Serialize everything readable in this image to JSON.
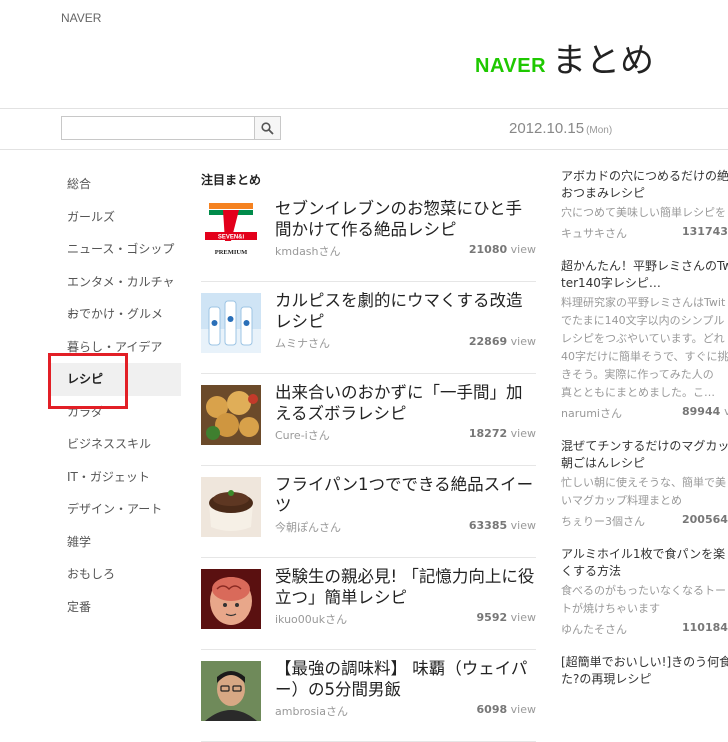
{
  "header": {
    "naver_label": "NAVER",
    "logo_naver": "NAVER",
    "logo_matome": "まとめ",
    "date": "2012.10.15",
    "day_of_week": "(Mon)"
  },
  "search": {
    "placeholder": "",
    "value": ""
  },
  "nav": {
    "items": [
      {
        "label": "総合"
      },
      {
        "label": "ガールズ"
      },
      {
        "label": "ニュース・ゴシップ"
      },
      {
        "label": "エンタメ・カルチャー"
      },
      {
        "label": "おでかけ・グルメ"
      },
      {
        "label": "暮らし・アイデア"
      },
      {
        "label": "レシピ"
      },
      {
        "label": "カラダ"
      },
      {
        "label": "ビジネススキル"
      },
      {
        "label": "IT・ガジェット"
      },
      {
        "label": "デザイン・アート"
      },
      {
        "label": "雑学"
      },
      {
        "label": "おもしろ"
      },
      {
        "label": "定番"
      }
    ],
    "active": "レシピ"
  },
  "main": {
    "section_title": "注目まとめ",
    "view_label": "view",
    "cards": [
      {
        "title": "セブンイレブンのお惣菜にひと手間かけて作る絶品レシピ",
        "author": "kmdashさん",
        "views": "21080",
        "thumb": "seven-eleven-premium"
      },
      {
        "title": "カルピスを劇的にウマくする改造レシピ",
        "author": "ムミナさん",
        "views": "22869",
        "thumb": "calpis-bottles"
      },
      {
        "title": "出来合いのおかずに「一手間」加えるズボラレシピ",
        "author": "Cure-iさん",
        "views": "18272",
        "thumb": "fried-food"
      },
      {
        "title": "フライパン1つでできる絶品スイーツ",
        "author": "今朝ぽんさん",
        "views": "63385",
        "thumb": "cake"
      },
      {
        "title": "受験生の親必見! 「記憶力向上に役立つ」簡単レシピ",
        "author": "ikuo00ukさん",
        "views": "9592",
        "thumb": "brain-illustration"
      },
      {
        "title": "【最強の調味料】 味覇（ウェイパー）の5分間男飯",
        "author": "ambrosiaさん",
        "views": "6098",
        "thumb": "portrait"
      }
    ]
  },
  "side": {
    "items": [
      {
        "title": [
          "アボカドの穴につめるだけの絶",
          "おつまみレシピ"
        ],
        "desc": [
          "穴につめて美味しい簡単レシピを"
        ],
        "author": "キュサキさん",
        "views": "131743",
        "view_label": "v"
      },
      {
        "title": [
          "超かんたん！平野レミさんのTw",
          "ter140字レシピ…"
        ],
        "desc": [
          "料理研究家の平野レミさんはTwit",
          "でたまに140文字以内のシンプル",
          "レシピをつぶやいています。どれ",
          "40字だけに簡単そうで、すぐに挑",
          "きそう。実際に作ってみた人の",
          "真とともにまとめました。こ…"
        ],
        "author": "narumiさん",
        "views": "89944",
        "view_label": "v"
      },
      {
        "title": [
          "混ぜてチンするだけのマグカッ",
          "朝ごはんレシピ"
        ],
        "desc": [
          "忙しい朝に使えそうな、簡単で美",
          "いマグカップ料理まとめ"
        ],
        "author": "ちぇりー3個さん",
        "views": "200564",
        "view_label": "v"
      },
      {
        "title": [
          "アルミホイル1枚で食パンを楽",
          "くする方法"
        ],
        "desc": [
          "食べるのがもったいなくなるトー",
          "トが焼けちゃいます"
        ],
        "author": "ゆんたそさん",
        "views": "110184",
        "view_label": "v"
      },
      {
        "title": [
          "[超簡単でおいしい!]きのう何食",
          "た?の再現レシピ"
        ],
        "desc": [],
        "author": "",
        "views": "",
        "view_label": ""
      }
    ]
  },
  "colors": {
    "brand_green": "#1ec800",
    "highlight_red": "#e21f26",
    "seven_orange": "#f58220",
    "seven_red": "#e3001b",
    "seven_green": "#008b4a"
  }
}
